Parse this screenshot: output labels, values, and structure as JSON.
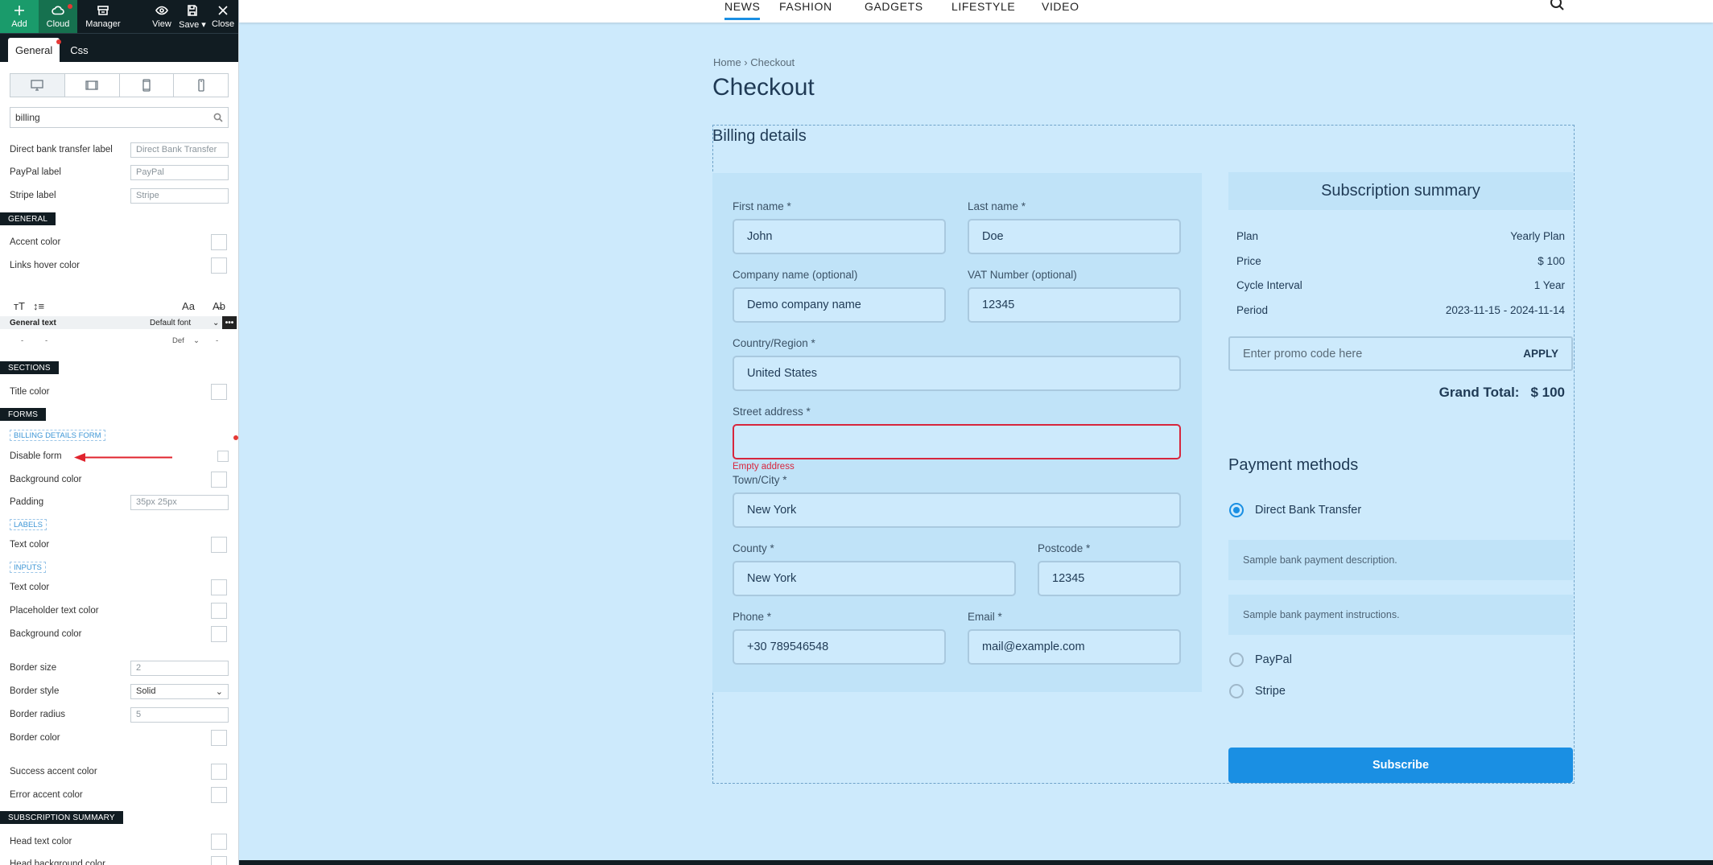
{
  "toolbar": {
    "add": "Add",
    "cloud": "Cloud",
    "manager": "Manager",
    "view": "View",
    "save": "Save ▾",
    "close": "Close"
  },
  "panel_tabs": {
    "general": "General",
    "css": "Css"
  },
  "search": {
    "value": "billing"
  },
  "panel_rows": {
    "direct_bank_label": "Direct bank transfer label",
    "direct_bank_value": "Direct Bank Transfer",
    "paypal_label": "PayPal label",
    "paypal_value": "PayPal",
    "stripe_label": "Stripe label",
    "stripe_value": "Stripe",
    "general_head": "GENERAL",
    "accent_color": "Accent color",
    "links_hover_color": "Links hover color",
    "general_text": "General text",
    "default_font": "Default font",
    "def": "Def",
    "sections_head": "SECTIONS",
    "title_color": "Title color",
    "forms_head": "FORMS",
    "billing_form_sub": "BILLING DETAILS FORM",
    "disable_form": "Disable form",
    "background_color": "Background color",
    "padding": "Padding",
    "padding_value": "35px 25px",
    "labels_sub": "LABELS",
    "text_color": "Text color",
    "inputs_sub": "INPUTS",
    "inputs_text_color": "Text color",
    "placeholder_text_color": "Placeholder text color",
    "inputs_background_color": "Background color",
    "border_size": "Border size",
    "border_size_value": "2",
    "border_style": "Border style",
    "border_style_value": "Solid",
    "border_radius": "Border radius",
    "border_radius_value": "5",
    "border_color": "Border color",
    "success_accent": "Success accent color",
    "error_accent": "Error accent color",
    "sub_summary_head": "SUBSCRIPTION SUMMARY",
    "head_text_color": "Head text color",
    "head_bg_color": "Head background color"
  },
  "nav": {
    "items": [
      "NEWS",
      "FASHION",
      "GADGETS",
      "LIFESTYLE",
      "VIDEO"
    ]
  },
  "breadcrumb": "Home › Checkout",
  "page_title": "Checkout",
  "billing": {
    "title": "Billing details",
    "first_name_label": "First name *",
    "first_name": "John",
    "last_name_label": "Last name *",
    "last_name": "Doe",
    "company_label": "Company name (optional)",
    "company": "Demo company name",
    "vat_label": "VAT Number (optional)",
    "vat": "12345",
    "country_label": "Country/Region *",
    "country": "United States",
    "street_label": "Street address *",
    "street": "",
    "street_error": "Empty address",
    "town_label": "Town/City *",
    "town": "New York",
    "county_label": "County *",
    "county": "New York",
    "postcode_label": "Postcode *",
    "postcode": "12345",
    "phone_label": "Phone *",
    "phone": "+30 789546548",
    "email_label": "Email *",
    "email": "mail@example.com"
  },
  "summary": {
    "title": "Subscription summary",
    "rows": [
      {
        "label": "Plan",
        "value": "Yearly Plan"
      },
      {
        "label": "Price",
        "value": "$ 100"
      },
      {
        "label": "Cycle Interval",
        "value": "1 Year"
      },
      {
        "label": "Period",
        "value": "2023-11-15 - 2024-11-14"
      }
    ],
    "promo_placeholder": "Enter promo code here",
    "apply": "APPLY",
    "grand_total_label": "Grand Total:",
    "grand_total_value": "$ 100"
  },
  "payment": {
    "title": "Payment methods",
    "bank": "Direct Bank Transfer",
    "bank_description": "Sample bank payment description.",
    "bank_instructions": "Sample bank payment instructions.",
    "paypal": "PayPal",
    "stripe": "Stripe",
    "subscribe": "Subscribe"
  },
  "colors": {
    "accent": "#1a8fe3",
    "error": "#d7263d",
    "page_bg": "#cdeafc",
    "panel_dark": "#111c22"
  }
}
